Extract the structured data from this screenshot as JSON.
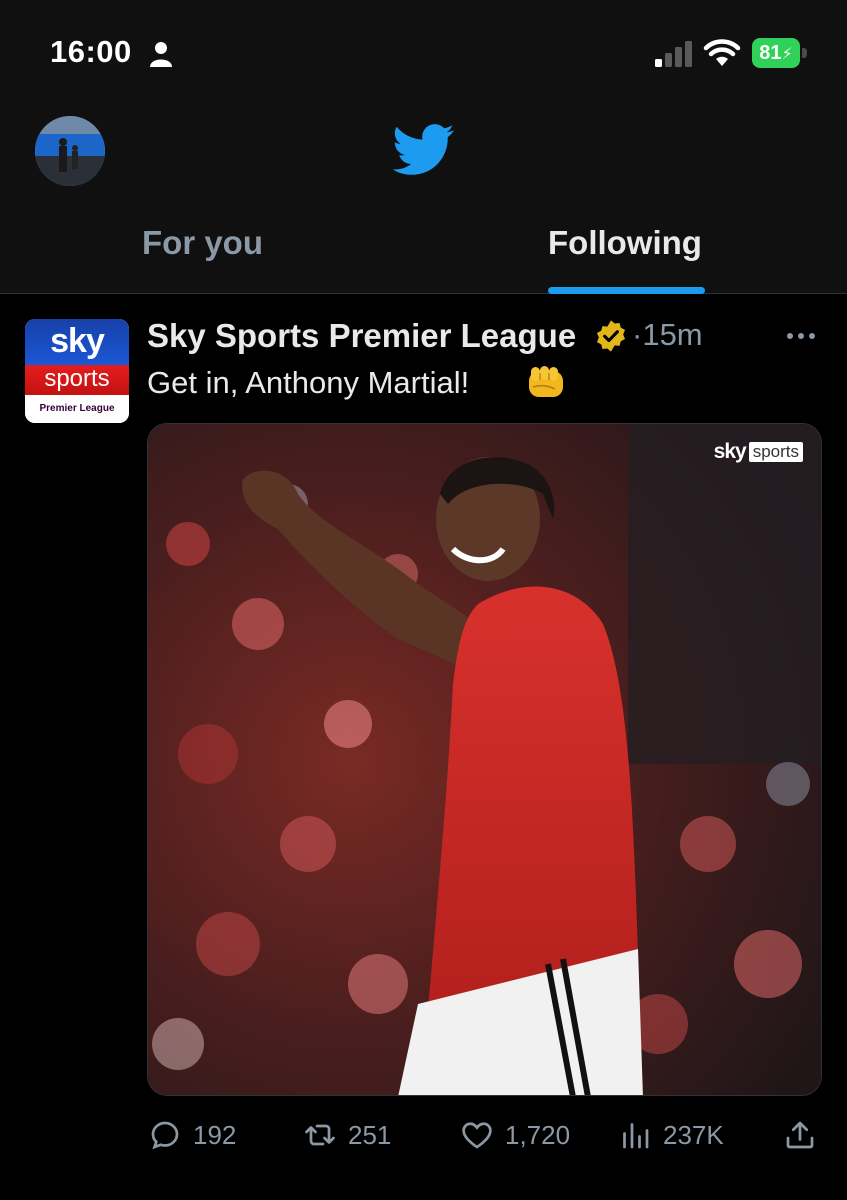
{
  "status_bar": {
    "time": "16:00",
    "battery": "81"
  },
  "header": {
    "tabs": [
      {
        "label": "For you",
        "active": false
      },
      {
        "label": "Following",
        "active": true
      }
    ]
  },
  "tweet": {
    "author_name": "Sky Sports Premier League",
    "time": "15m",
    "text": "Get in, Anthony Martial!",
    "avatar_logo": {
      "line1": "sky",
      "line2": "sports",
      "line3": "Premier League"
    },
    "media_watermark": {
      "brand": "sky",
      "product": "sports"
    },
    "stats": {
      "replies": "192",
      "retweets": "251",
      "likes": "1,720",
      "views": "237K"
    }
  },
  "colors": {
    "accent": "#1d9bf0",
    "verified": "#e2b719",
    "muted": "#8b98a5",
    "battery": "#30d158"
  }
}
